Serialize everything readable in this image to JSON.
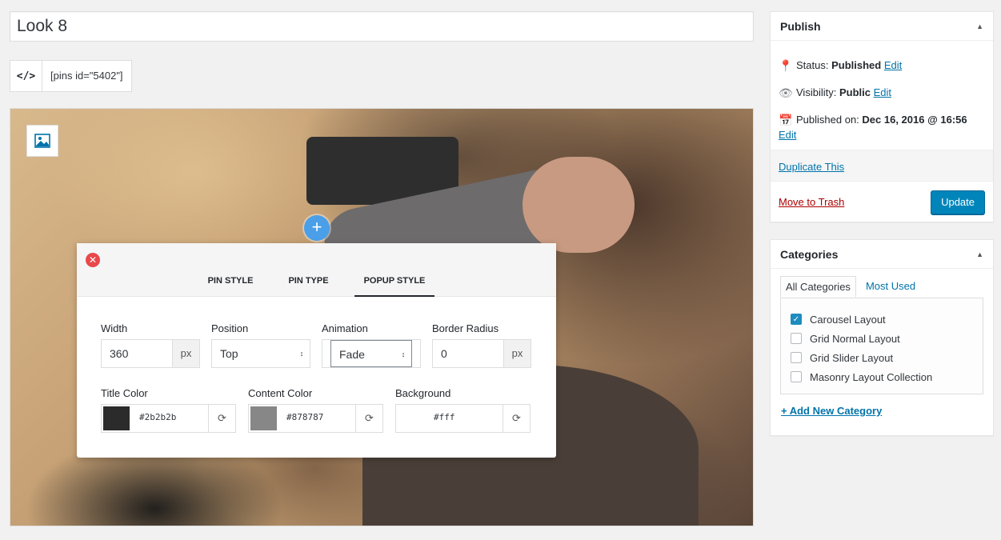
{
  "title_field": {
    "value": "Look 8"
  },
  "shortcode": {
    "text": "[pins id=\"5402\"]",
    "code_icon": "code-icon"
  },
  "canvas": {
    "image_icon": "image-icon",
    "pin_symbol": "+"
  },
  "popup": {
    "close_symbol": "✕",
    "tabs": [
      "PIN STYLE",
      "PIN TYPE",
      "POPUP STYLE"
    ],
    "active_tab": "POPUP STYLE",
    "width": {
      "label": "Width",
      "value": "360",
      "unit": "px"
    },
    "position": {
      "label": "Position",
      "value": "Top"
    },
    "animation": {
      "label": "Animation",
      "value": "Fade"
    },
    "border_radius": {
      "label": "Border Radius",
      "value": "0",
      "unit": "px"
    },
    "title_color": {
      "label": "Title Color",
      "value": "#2b2b2b"
    },
    "content_color": {
      "label": "Content Color",
      "value": "#878787"
    },
    "background": {
      "label": "Background",
      "value": "#fff"
    }
  },
  "publish": {
    "heading": "Publish",
    "status_label": "Status:",
    "status_value": "Published",
    "visibility_label": "Visibility:",
    "visibility_value": "Public",
    "published_label": "Published on:",
    "published_value": "Dec 16, 2016 @ 16:56",
    "edit": "Edit",
    "duplicate": "Duplicate This",
    "trash": "Move to Trash",
    "update": "Update"
  },
  "categories": {
    "heading": "Categories",
    "tab_all": "All Categories",
    "tab_most": "Most Used",
    "items": [
      {
        "label": "Carousel Layout",
        "checked": true
      },
      {
        "label": "Grid Normal Layout",
        "checked": false
      },
      {
        "label": "Grid Slider Layout",
        "checked": false
      },
      {
        "label": "Masonry Layout Collection",
        "checked": false
      }
    ],
    "add_new": "+ Add New Category"
  },
  "colors": {
    "accent": "#0085ba",
    "link": "#0073aa",
    "danger": "#a00",
    "close": "#e8494b",
    "pin": "#4a9fe8"
  }
}
